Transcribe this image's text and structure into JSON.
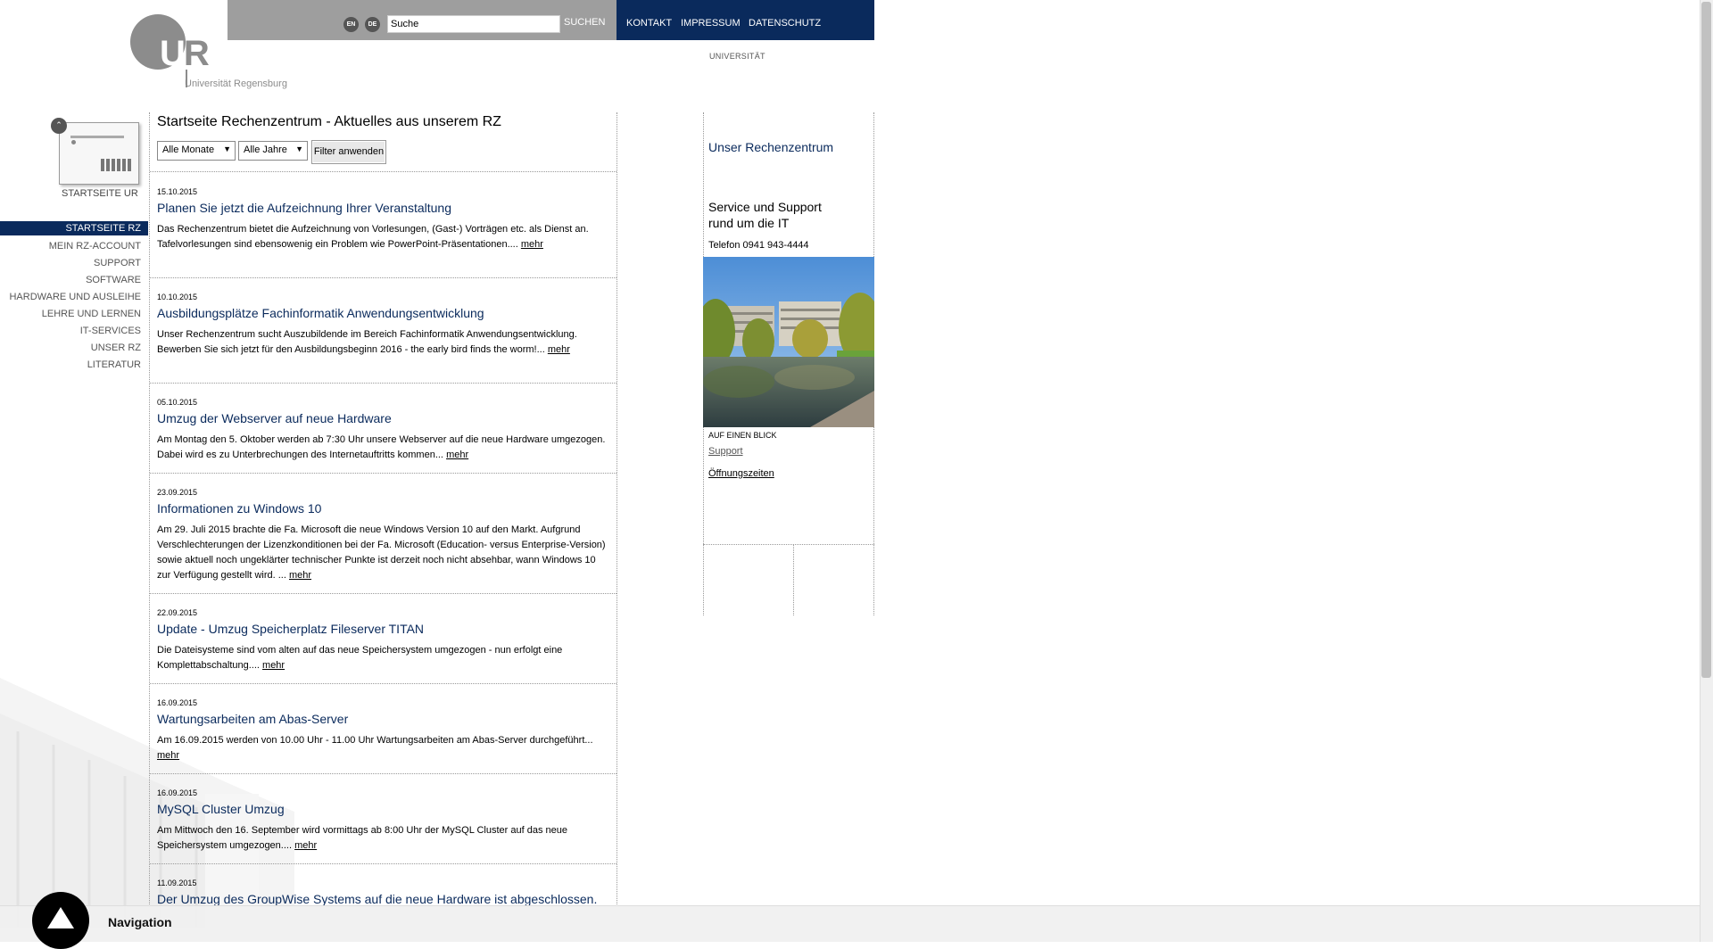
{
  "logo": {
    "letters_u": "U",
    "letters_r": "R",
    "name": "Universität Regensburg"
  },
  "topbar": {
    "lang_en": "EN",
    "lang_de": "DE",
    "search_value": "Suche",
    "search_button": "SUCHEN",
    "links": [
      "KONTAKT",
      "IMPRESSUM",
      "DATENSCHUTZ"
    ],
    "section_label": "UNIVERSITÄT"
  },
  "nav": {
    "home_ur": "STARTSEITE UR",
    "collapse_glyph": "⌃",
    "items": [
      {
        "label": "STARTSEITE RZ",
        "active": true
      },
      {
        "label": "MEIN RZ-ACCOUNT"
      },
      {
        "label": "SUPPORT"
      },
      {
        "label": "SOFTWARE"
      },
      {
        "label": "HARDWARE UND AUSLEIHE"
      },
      {
        "label": "LEHRE UND LERNEN"
      },
      {
        "label": "IT-SERVICES"
      },
      {
        "label": "UNSER RZ"
      },
      {
        "label": "LITERATUR"
      }
    ]
  },
  "main": {
    "title": "Startseite Rechenzentrum - Aktuelles aus unserem RZ",
    "filter": {
      "months": "Alle Monate",
      "years": "Alle Jahre",
      "apply": "Filter anwenden",
      "arrow": "▼"
    },
    "more_label": "mehr",
    "articles": [
      {
        "date": "15.10.2015",
        "title": "Planen Sie jetzt die Aufzeichnung Ihrer Veranstaltung",
        "text": "Das Rechenzentrum bietet die Aufzeichnung von Vorlesungen, (Gast-) Vorträgen etc. als Dienst an. Tafelvorlesungen sind ebensowenig ein Problem wie PowerPoint-Präsentationen...."
      },
      {
        "date": "10.10.2015",
        "title": "Ausbildungsplätze Fachinformatik Anwendungsentwicklung",
        "text": "Unser Rechenzentrum sucht Auszubildende im Bereich Fachinformatik Anwendungsentwicklung. Bewerben Sie sich jetzt für den Ausbildungsbeginn 2016 - the early bird finds the worm!..."
      },
      {
        "date": "05.10.2015",
        "title": "Umzug der Webserver auf neue Hardware",
        "text": "Am Montag den 5. Oktober werden ab 7:30 Uhr unsere Webserver auf die neue Hardware umgezogen. Dabei wird es zu Unterbrechungen des Internetauftritts kommen..."
      },
      {
        "date": "23.09.2015",
        "title": "Informationen zu Windows 10",
        "text": "Am 29. Juli 2015 brachte die Fa. Microsoft die neue Windows Version 10 auf den Markt. Aufgrund Verschlechterungen der Lizenzkonditionen bei der Fa. Microsoft (Education- versus Enterprise-Version) sowie aktuell noch ungeklärter technischer Punkte ist derzeit noch nicht absehbar, wann Windows 10 zur Verfügung gestellt wird. ..."
      },
      {
        "date": "22.09.2015",
        "title": "Update - Umzug Speicherplatz Fileserver TITAN",
        "text": "Die Dateisysteme sind vom alten auf das neue Speichersystem umgezogen - nun erfolgt eine Komplettabschaltung...."
      },
      {
        "date": "16.09.2015",
        "title": "Wartungsarbeiten am Abas-Server",
        "text": "Am 16.09.2015 werden von 10.00 Uhr - 11.00 Uhr Wartungsarbeiten am Abas-Server durchgeführt..."
      },
      {
        "date": "16.09.2015",
        "title": "MySQL Cluster Umzug",
        "text": "Am Mittwoch den 16. September wird vormittags ab 8:00 Uhr der MySQL Cluster auf das neue Speichersystem umgezogen...."
      },
      {
        "date": "11.09.2015",
        "title": "Der Umzug des GroupWise Systems auf die neue Hardware ist abgeschlossen.",
        "text": ""
      }
    ]
  },
  "sidebar": {
    "title": "Unser Rechenzentrum",
    "service_line1": "Service und Support",
    "service_line2": "rund um die IT",
    "phone": "Telefon 0941 943-4444",
    "at_a_glance": "AUF EINEN BLICK",
    "support_link": "Support",
    "hours_link": "Öffnungszeiten"
  },
  "bottom": {
    "label": "Navigation"
  },
  "colors": {
    "navy": "#0a2a5c",
    "gray_bar": "#9e9e9e",
    "logo_gray": "#8c8c8c"
  }
}
